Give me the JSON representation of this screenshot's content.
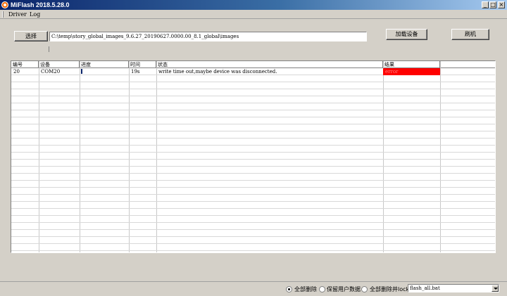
{
  "window": {
    "title": "MiFlash 2018.5.28.0",
    "icon": "mi-logo-icon"
  },
  "menu": {
    "items": [
      "Driver",
      "Log"
    ]
  },
  "toolbar": {
    "select_label": "选择",
    "path_value": "C:\\temp\\story_global_images_9.6.27_20190627.0000.00_8.1_global\\images",
    "load_device_label": "加载设备",
    "flash_label": "刷机"
  },
  "table": {
    "columns": [
      "编号",
      "设备",
      "进度",
      "时间",
      "状态",
      "结果"
    ],
    "rows": [
      {
        "id": "20",
        "device": "COM20",
        "progress": 0,
        "time": "19s",
        "status": "write time out,maybe device was disconnected.",
        "result": "error",
        "result_color": "#ff0000"
      }
    ]
  },
  "footer": {
    "options": [
      {
        "label": "全部删除",
        "selected": true
      },
      {
        "label": "保留用户数据",
        "selected": false
      },
      {
        "label": "全部删除并lock",
        "selected": false
      }
    ],
    "script_select": "flash_all.bat"
  },
  "colors": {
    "title_bar": "#0a246a",
    "window_bg": "#d4d0c8",
    "error": "#ff0000"
  }
}
